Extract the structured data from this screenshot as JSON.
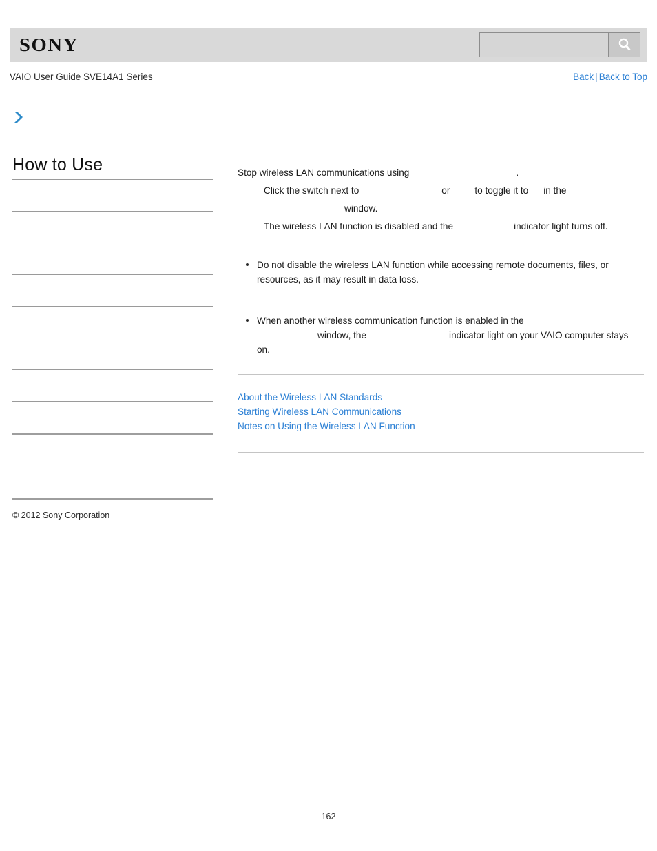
{
  "header": {
    "logo_text": "SONY",
    "search": {
      "value": "",
      "placeholder": "",
      "icon": "search-icon"
    }
  },
  "title_row": {
    "guide_title": "VAIO User Guide SVE14A1 Series",
    "back_label": "Back",
    "separator": "|",
    "back_to_top_label": "Back to Top"
  },
  "sidebar": {
    "chevron_icon": "chevron-right-icon",
    "heading": "How to Use",
    "items": [
      {
        "label": ""
      },
      {
        "label": ""
      },
      {
        "label": ""
      },
      {
        "label": ""
      },
      {
        "label": ""
      },
      {
        "label": ""
      },
      {
        "label": ""
      },
      {
        "label": ""
      },
      {
        "label": ""
      },
      {
        "label": ""
      }
    ]
  },
  "content": {
    "steps": [
      {
        "text_before": "Stop wireless LAN communications using",
        "text_after": "."
      }
    ],
    "step_line_1": "Stop wireless LAN communications using",
    "step_line_1_end": ".",
    "step_line_2a": "Click the switch next to",
    "step_line_2b": "or",
    "step_line_2c": "to toggle it to",
    "step_line_2d": "in the",
    "step_line_3": "window.",
    "step_line_4a": "The wireless LAN function is disabled and the",
    "step_line_4b": "indicator light turns off.",
    "notes": [
      {
        "line1": "Do not disable the wireless LAN function while accessing remote documents, files, or",
        "line2": "resources, as it may result in data loss."
      },
      {
        "line1": "When another wireless communication function is enabled in the",
        "line2a": "window, the",
        "line2b": "indicator light on your VAIO computer stays on."
      }
    ],
    "related_links": [
      "About the Wireless LAN Standards",
      "Starting Wireless LAN Communications",
      "Notes on Using the Wireless LAN Function"
    ]
  },
  "footer": {
    "copyright": "© 2012 Sony Corporation",
    "page_number": "162"
  },
  "colors": {
    "header_bg": "#d9d9d9",
    "link_blue": "#2a7fd4",
    "chevron_blue": "#2e8bc9",
    "divider_gray": "#9a9a9a",
    "rule_gray": "#c4c4c4"
  }
}
